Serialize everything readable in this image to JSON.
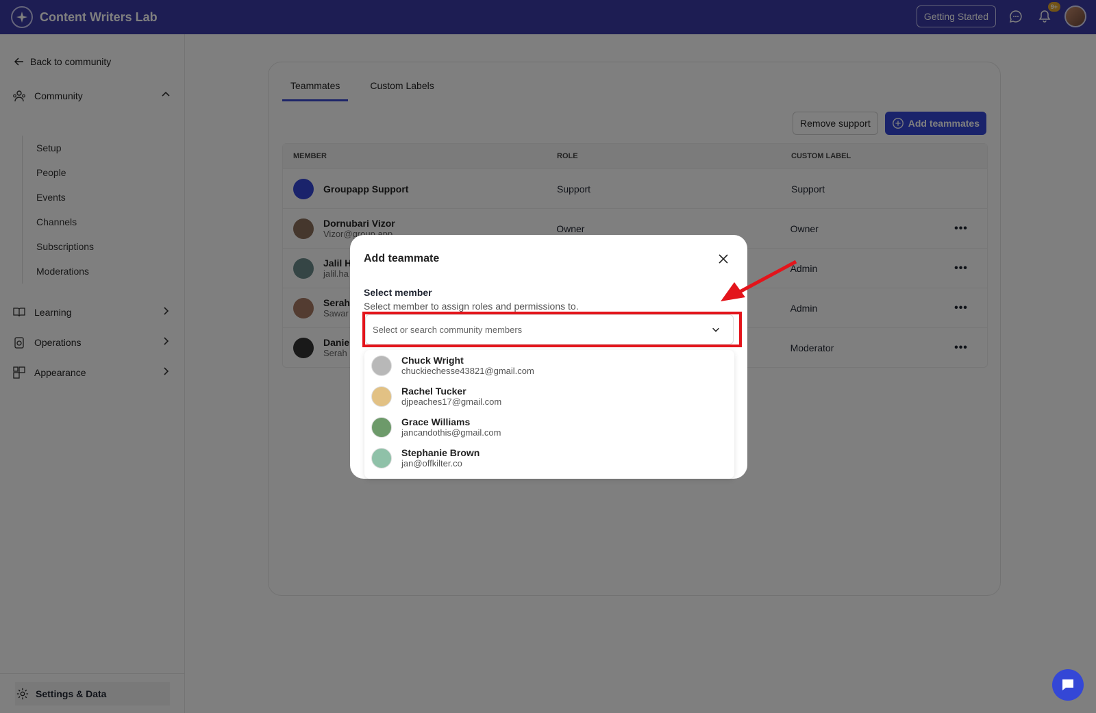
{
  "app": {
    "title": "Content Writers Lab",
    "getting_started": "Getting Started",
    "notif_badge": "9+"
  },
  "sidebar": {
    "back": "Back to community",
    "groups": [
      {
        "label": "Community",
        "icon": "community-icon"
      },
      {
        "label": "Learning",
        "icon": "book-icon"
      },
      {
        "label": "Operations",
        "icon": "operations-icon"
      },
      {
        "label": "Appearance",
        "icon": "appearance-icon"
      }
    ],
    "community_items": [
      "Setup",
      "People",
      "Events",
      "Channels",
      "Subscriptions",
      "Moderations"
    ],
    "settings": "Settings & Data"
  },
  "main": {
    "tabs": [
      {
        "label": "Teammates",
        "active": true
      },
      {
        "label": "Custom Labels",
        "active": false
      }
    ],
    "remove_support": "Remove support",
    "add_teammates": "Add teammates",
    "columns": [
      "MEMBER",
      "ROLE",
      "CUSTOM LABEL"
    ],
    "rows": [
      {
        "name": "Groupapp Support",
        "email": "",
        "role": "Support",
        "label": "Support"
      },
      {
        "name": "Dornubari Vizor",
        "email": "Vizor@group.app",
        "role": "Owner",
        "label": "Owner"
      },
      {
        "name": "Jalil H",
        "email": "jalil.ha",
        "role": "",
        "label": "Admin"
      },
      {
        "name": "Serah",
        "email": "Sawar",
        "role": "",
        "label": "Admin"
      },
      {
        "name": "Daniel",
        "email": "Serah",
        "role": "",
        "label": "Moderator"
      }
    ],
    "more": "•••"
  },
  "modal": {
    "title": "Add teammate",
    "field_label": "Select member",
    "field_help": "Select member to assign roles and permissions to.",
    "placeholder": "Select or search community members",
    "options": [
      {
        "name": "Chuck Wright",
        "email": "chuckiechesse43821@gmail.com",
        "color": "#b8b8b8"
      },
      {
        "name": "Rachel Tucker",
        "email": "djpeaches17@gmail.com",
        "color": "#e2c184"
      },
      {
        "name": "Grace Williams",
        "email": "jancandothis@gmail.com",
        "color": "#6d9a6a"
      },
      {
        "name": "Stephanie Brown",
        "email": "jan@offkilter.co",
        "color": "#8fc1a8"
      }
    ]
  },
  "colors": {
    "topbar": "#3b3aa6",
    "primary": "#3447d6",
    "highlight": "#e3141b"
  }
}
